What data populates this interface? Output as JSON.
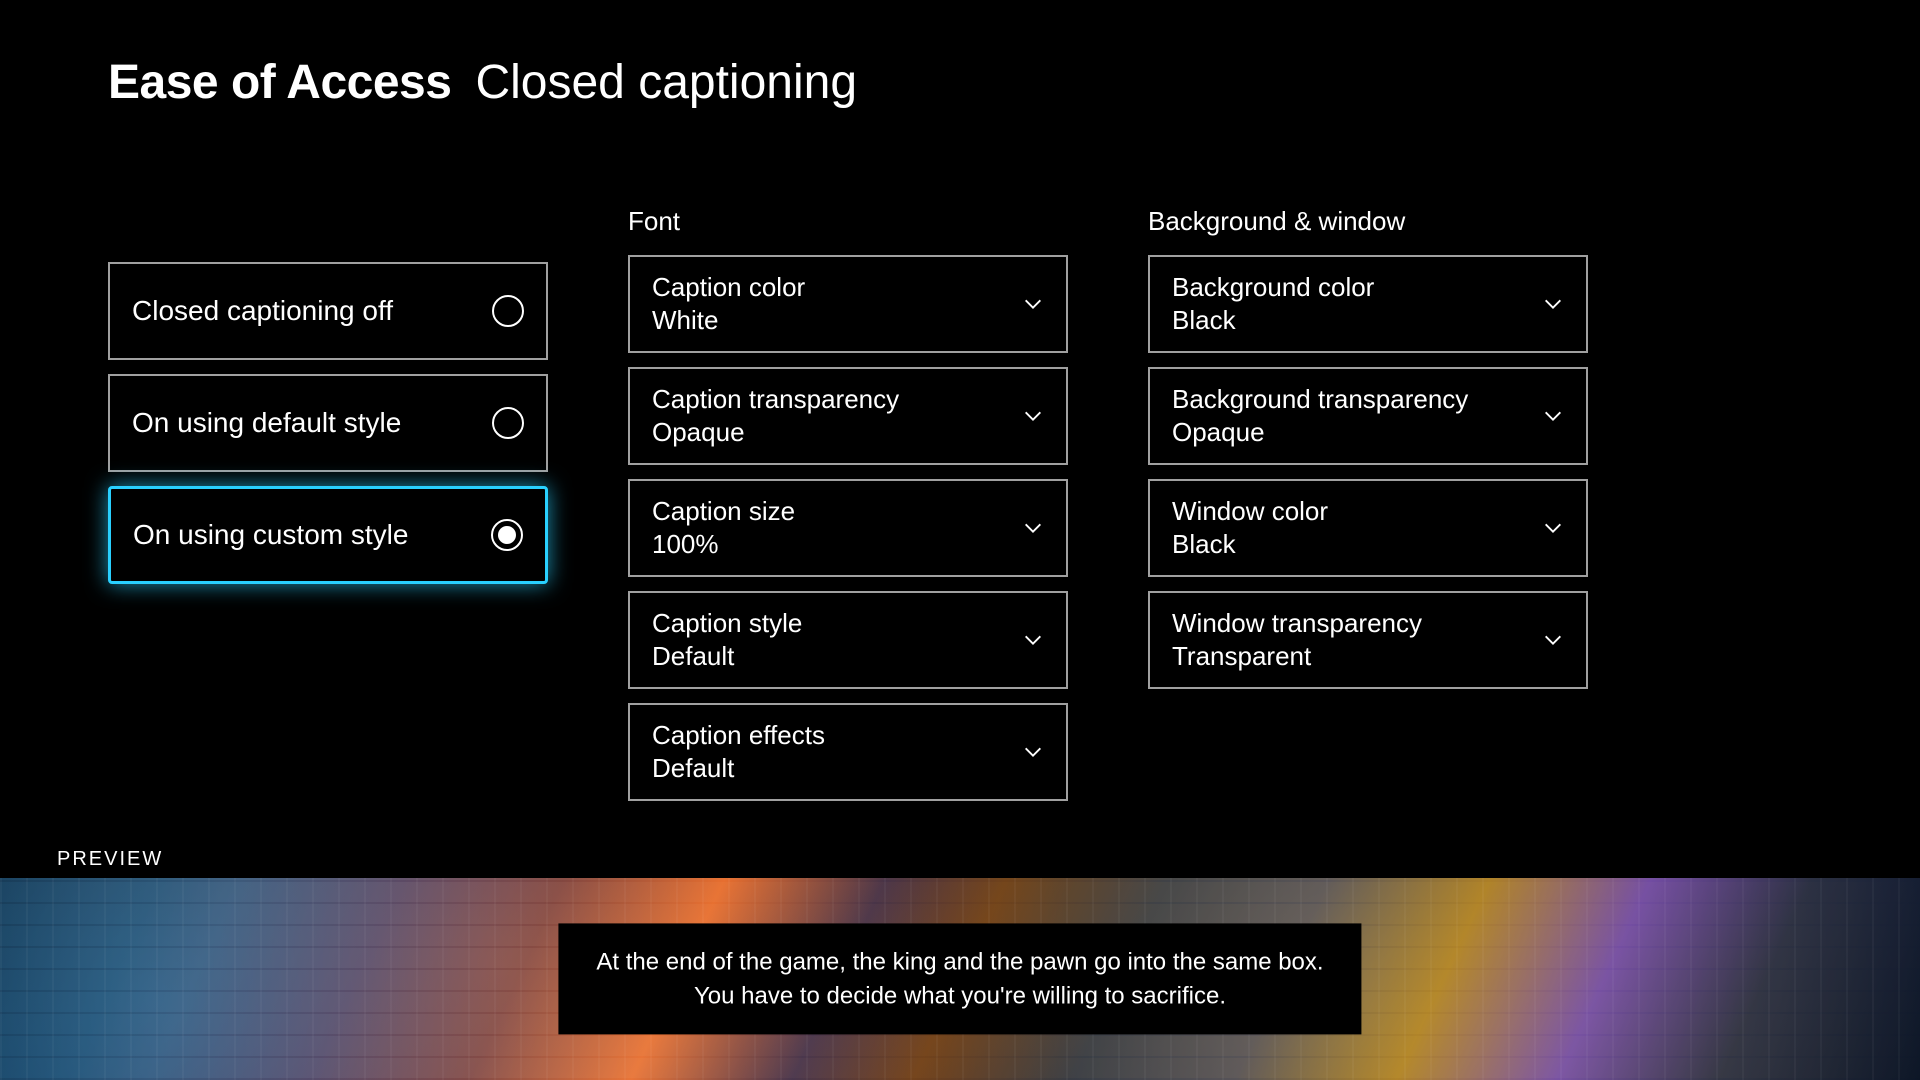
{
  "header": {
    "category": "Ease of Access",
    "page": "Closed captioning"
  },
  "mode": {
    "options": [
      {
        "label": "Closed captioning off",
        "selected": false
      },
      {
        "label": "On using default style",
        "selected": false
      },
      {
        "label": "On using custom style",
        "selected": true
      }
    ]
  },
  "font": {
    "title": "Font",
    "items": [
      {
        "label": "Caption color",
        "value": "White"
      },
      {
        "label": "Caption transparency",
        "value": "Opaque"
      },
      {
        "label": "Caption size",
        "value": "100%"
      },
      {
        "label": "Caption style",
        "value": "Default"
      },
      {
        "label": "Caption effects",
        "value": "Default"
      }
    ]
  },
  "bgwindow": {
    "title": "Background & window",
    "items": [
      {
        "label": "Background color",
        "value": "Black"
      },
      {
        "label": "Background transparency",
        "value": "Opaque"
      },
      {
        "label": "Window color",
        "value": "Black"
      },
      {
        "label": "Window transparency",
        "value": "Transparent"
      }
    ]
  },
  "preview": {
    "label": "PREVIEW",
    "line1": "At the end of the game, the king and the pawn go into the same box.",
    "line2": "You have to decide what you're willing to sacrifice."
  }
}
